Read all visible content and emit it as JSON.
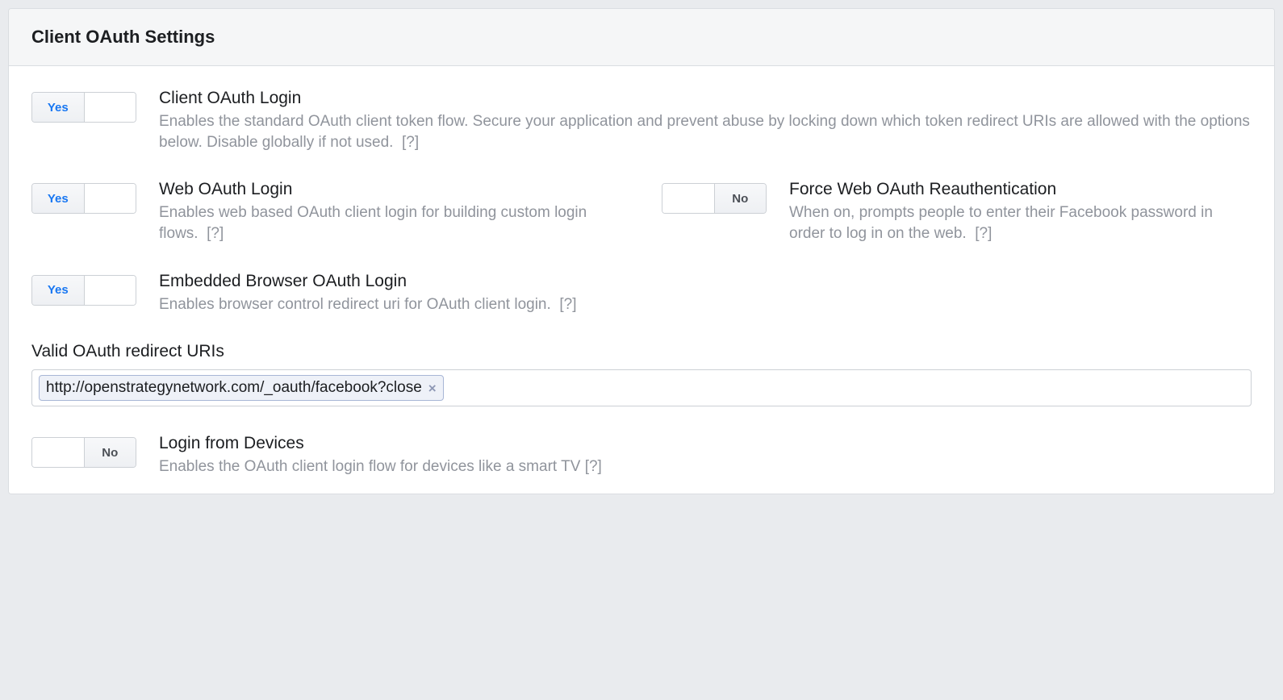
{
  "header": {
    "title": "Client OAuth Settings"
  },
  "labels": {
    "yes": "Yes",
    "no": "No",
    "help": "[?]"
  },
  "settings": {
    "client_oauth_login": {
      "title": "Client OAuth Login",
      "desc": "Enables the standard OAuth client token flow. Secure your application and prevent abuse by locking down which token redirect URIs are allowed with the options below. Disable globally if not used."
    },
    "web_oauth_login": {
      "title": "Web OAuth Login",
      "desc": "Enables web based OAuth client login for building custom login flows."
    },
    "force_reauth": {
      "title": "Force Web OAuth Reauthentication",
      "desc": "When on, prompts people to enter their Facebook password in order to log in on the web."
    },
    "embedded_browser": {
      "title": "Embedded Browser OAuth Login",
      "desc": "Enables browser control redirect uri for OAuth client login."
    },
    "login_devices": {
      "title": "Login from Devices",
      "desc": "Enables the OAuth client login flow for devices like a smart TV"
    }
  },
  "redirect_uris": {
    "label": "Valid OAuth redirect URIs",
    "token": "http://openstrategynetwork.com/_oauth/facebook?close"
  }
}
